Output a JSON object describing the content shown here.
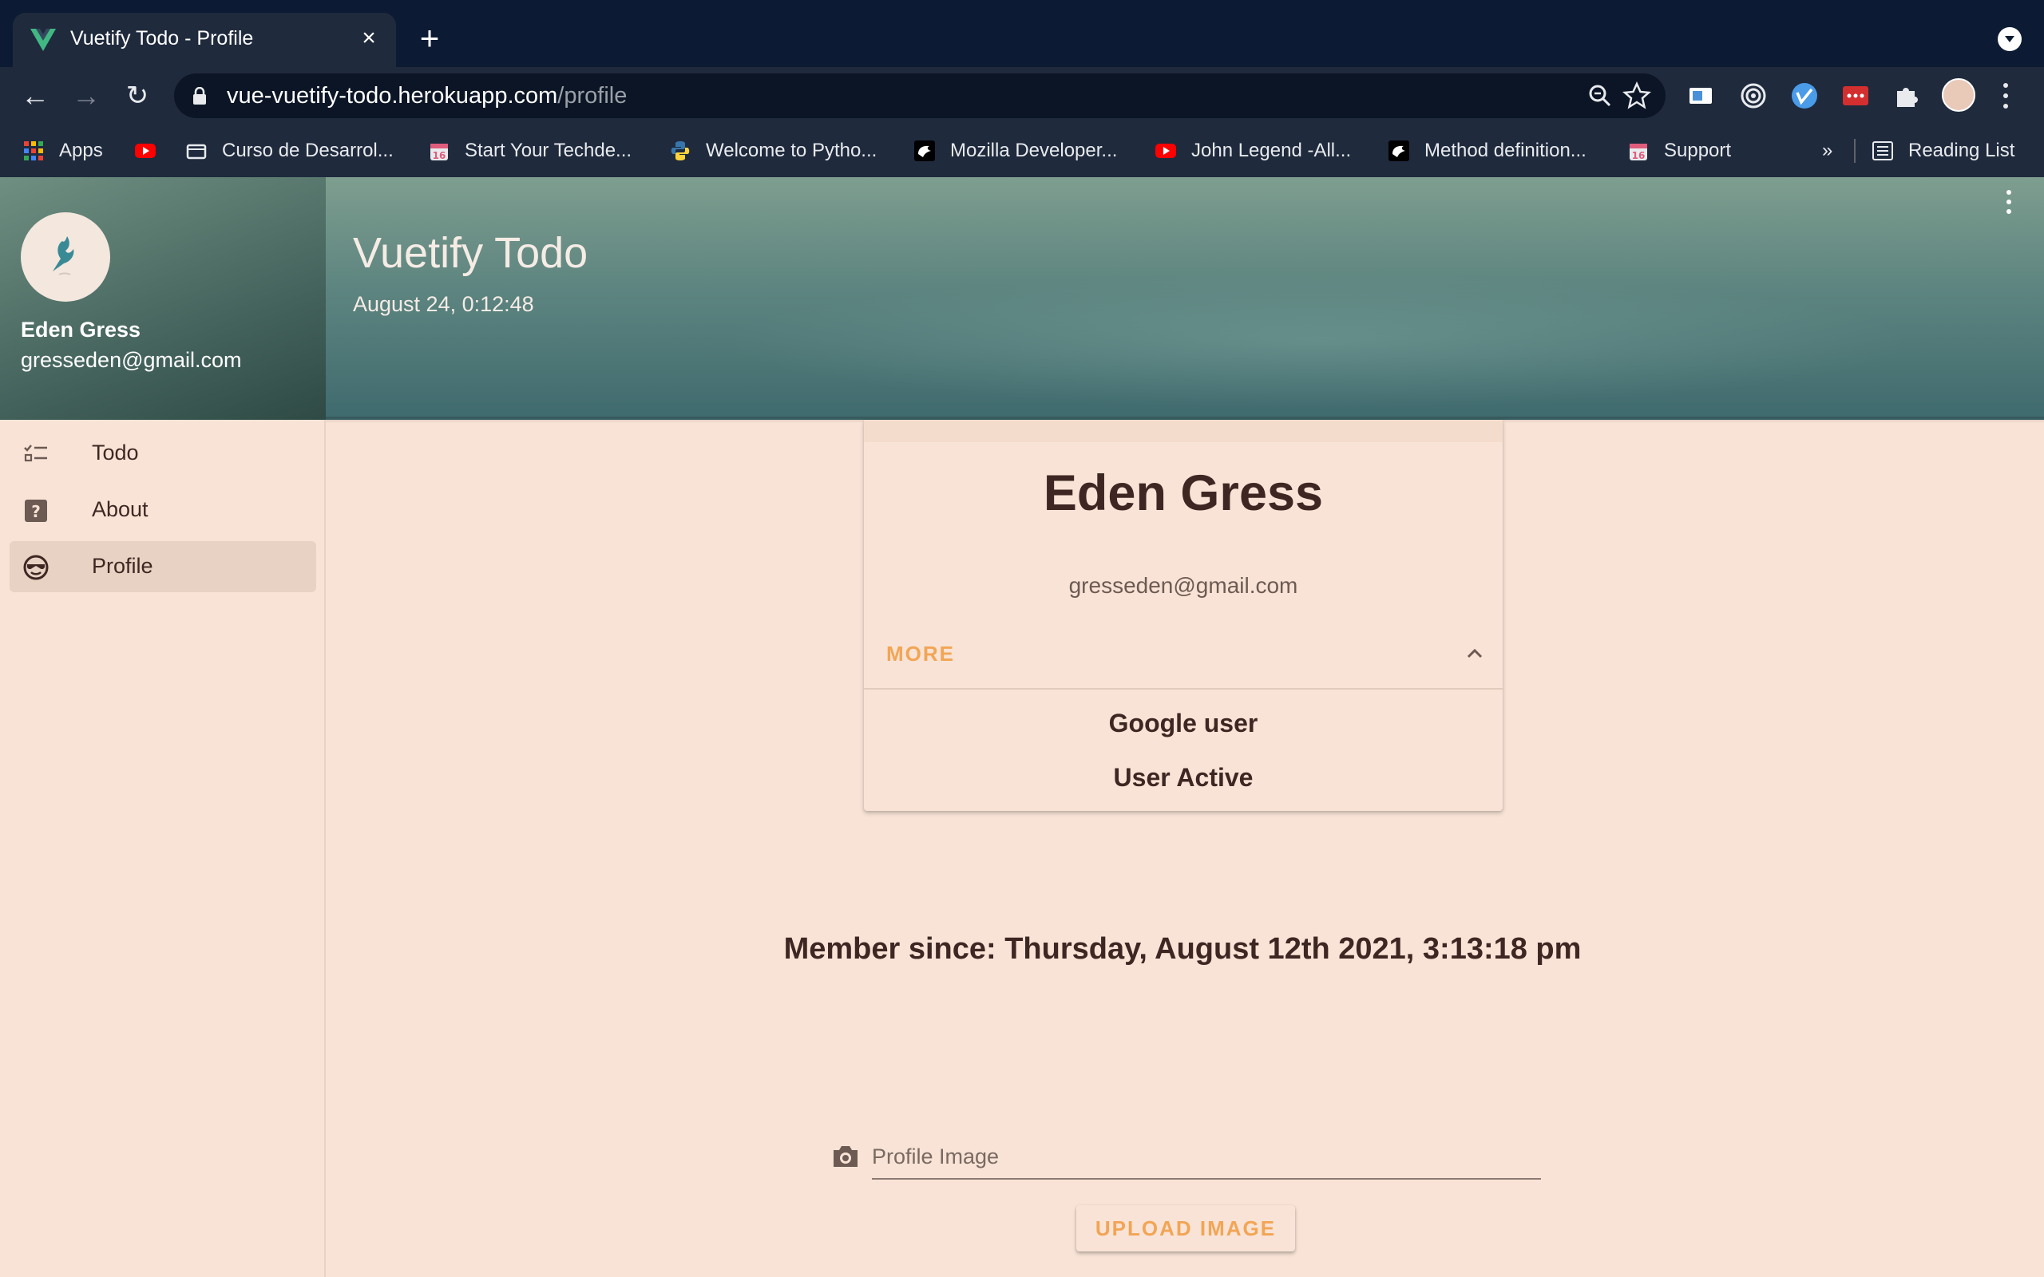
{
  "browser": {
    "tab_title": "Vuetify Todo - Profile",
    "url_host": "vue-vuetify-todo.herokuapp.com",
    "url_path": "/profile",
    "bookmarks": [
      {
        "label": "Apps",
        "icon": "apps-grid-icon"
      },
      {
        "label": "",
        "icon": "youtube-icon"
      },
      {
        "label": "Curso de Desarrol...",
        "icon": "course-icon"
      },
      {
        "label": "Start Your Techde...",
        "icon": "calendar-16-icon"
      },
      {
        "label": "Welcome to Pytho...",
        "icon": "python-icon"
      },
      {
        "label": "Mozilla Developer...",
        "icon": "mdn-icon"
      },
      {
        "label": "John Legend -All...",
        "icon": "youtube-icon"
      },
      {
        "label": "Method definition...",
        "icon": "mdn-icon"
      },
      {
        "label": "Support",
        "icon": "calendar-16-icon"
      }
    ],
    "bookmarks_overflow": "»",
    "reading_list": "Reading List"
  },
  "drawer": {
    "user_name": "Eden Gress",
    "user_email": "gresseden@gmail.com",
    "nav": [
      {
        "label": "Todo",
        "icon": "todo-list-icon",
        "active": false
      },
      {
        "label": "About",
        "icon": "help-box-icon",
        "active": false
      },
      {
        "label": "Profile",
        "icon": "sunglasses-face-icon",
        "active": true
      }
    ]
  },
  "header": {
    "title": "Vuetify Todo",
    "datetime": "August 24, 0:12:48"
  },
  "profile_card": {
    "name": "Eden Gress",
    "email": "gresseden@gmail.com",
    "more_label": "MORE",
    "details": [
      "Google user",
      "User Active"
    ]
  },
  "member_since": "Member since: Thursday, August 12th 2021, 3:13:18 pm",
  "upload": {
    "placeholder": "Profile Image",
    "button_label": "UPLOAD IMAGE"
  },
  "colors": {
    "background": "#f8e3d6",
    "accent": "#f2a555",
    "text": "#3e2723",
    "chrome_dark": "#0c1b33"
  }
}
